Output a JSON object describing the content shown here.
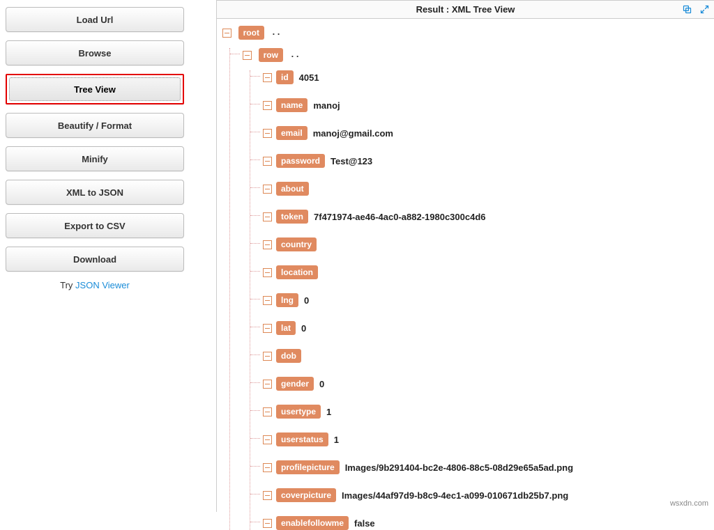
{
  "sidebar": {
    "buttons": [
      "Load Url",
      "Browse",
      "Tree View",
      "Beautify / Format",
      "Minify",
      "XML to JSON",
      "Export to CSV",
      "Download"
    ],
    "selected_index": 2,
    "try_prefix": "Try ",
    "try_link": "JSON Viewer"
  },
  "result": {
    "title": "Result : XML Tree View"
  },
  "tree": {
    "root_tag": "root",
    "root_dots": ". .",
    "row_tag": "row",
    "row_dots": ". .",
    "fields": [
      {
        "tag": "id",
        "value": "4051"
      },
      {
        "tag": "name",
        "value": "manoj"
      },
      {
        "tag": "email",
        "value": "manoj@gmail.com"
      },
      {
        "tag": "password",
        "value": "Test@123"
      },
      {
        "tag": "about",
        "value": ""
      },
      {
        "tag": "token",
        "value": "7f471974-ae46-4ac0-a882-1980c300c4d6"
      },
      {
        "tag": "country",
        "value": ""
      },
      {
        "tag": "location",
        "value": ""
      },
      {
        "tag": "lng",
        "value": "0"
      },
      {
        "tag": "lat",
        "value": "0"
      },
      {
        "tag": "dob",
        "value": ""
      },
      {
        "tag": "gender",
        "value": "0"
      },
      {
        "tag": "usertype",
        "value": "1"
      },
      {
        "tag": "userstatus",
        "value": "1"
      },
      {
        "tag": "profilepicture",
        "value": "Images/9b291404-bc2e-4806-88c5-08d29e65a5ad.png"
      },
      {
        "tag": "coverpicture",
        "value": "Images/44af97d9-b8c9-4ec1-a099-010671db25b7.png"
      },
      {
        "tag": "enablefollowme",
        "value": "false"
      }
    ]
  },
  "watermark": "wsxdn.com"
}
